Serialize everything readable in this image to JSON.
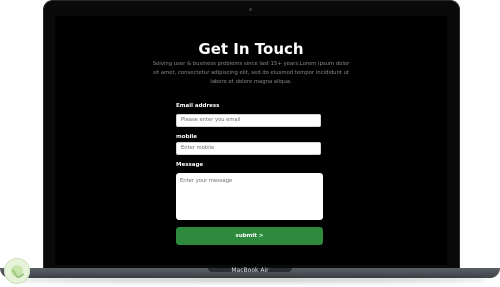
{
  "device": {
    "model_label": "MacBook Air"
  },
  "page": {
    "title": "Get In Touch",
    "subtitle": "Solving user & business problems since last 15+ years.Lorem ipsum dolor sit amet, consectetur adipiscing elit, sed do eiusmod tempor incididunt ut labore et dolore magna aliqua."
  },
  "form": {
    "email": {
      "label": "Email address",
      "placeholder": "Please enter you email"
    },
    "mobile": {
      "label": "mobile",
      "placeholder": "Enter mobile"
    },
    "message": {
      "label": "Message",
      "placeholder": "Enter your message"
    },
    "submit_label": "submit >"
  },
  "colors": {
    "screen_bg": "#000000",
    "submit_bg": "#2e8b3e",
    "text_primary": "#ffffff",
    "text_muted": "#8b8b8b"
  }
}
